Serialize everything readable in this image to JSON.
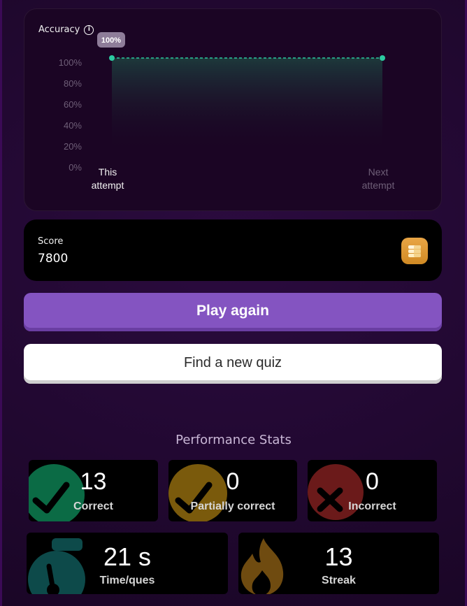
{
  "accuracy": {
    "title": "Accuracy",
    "info_icon": "info-icon",
    "tooltip": "100%",
    "y_ticks": [
      "100%",
      "80%",
      "60%",
      "40%",
      "20%",
      "0%"
    ],
    "x_labels": [
      [
        "This",
        "attempt"
      ],
      [
        "Next",
        "attempt"
      ]
    ],
    "colors": {
      "line": "#2cc9a0",
      "area_top": "#1d3b3c"
    }
  },
  "chart_data": {
    "type": "line",
    "title": "Accuracy",
    "categories": [
      "This attempt",
      "Next attempt"
    ],
    "values": [
      100,
      100
    ],
    "ylim": [
      0,
      100
    ],
    "y_ticks": [
      "0%",
      "20%",
      "40%",
      "60%",
      "80%",
      "100%"
    ],
    "grid": false,
    "line_style": "dashed"
  },
  "score": {
    "label": "Score",
    "value": "7800",
    "icon": "coins-icon"
  },
  "buttons": {
    "play_again": "Play again",
    "find_quiz": "Find a new quiz"
  },
  "performance": {
    "title": "Performance Stats",
    "stats": [
      {
        "value": "13",
        "label": "Correct",
        "icon": "check-icon",
        "color": "#0b6b45"
      },
      {
        "value": "0",
        "label": "Partially correct",
        "icon": "check-icon",
        "color": "#7a5a0c"
      },
      {
        "value": "0",
        "label": "Incorrect",
        "icon": "close-icon",
        "color": "#6b1a1a"
      },
      {
        "value": "21 s",
        "label": "Time/ques",
        "icon": "stopwatch-icon",
        "color": "#0d5a5a"
      },
      {
        "value": "13",
        "label": "Streak",
        "icon": "fire-icon",
        "color": "#6f4b10"
      }
    ]
  }
}
